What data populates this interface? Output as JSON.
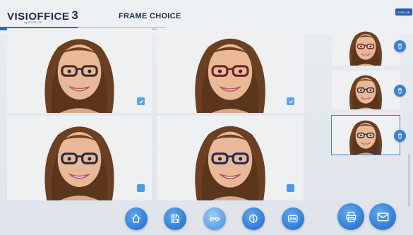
{
  "header": {
    "logo_main": "VISIOFFICE",
    "logo_number": "3",
    "logo_subtitle": "by ESSILOR",
    "page_title": "FRAME CHOICE",
    "progress": 0.47,
    "brand_badge": "ESSILOR"
  },
  "photos": [
    {
      "name": "photo-frame-1",
      "checked": true
    },
    {
      "name": "photo-frame-2",
      "checked": true
    },
    {
      "name": "photo-frame-3",
      "checked": false
    },
    {
      "name": "photo-frame-4",
      "checked": false
    }
  ],
  "thumbnails": [
    {
      "name": "thumbnail-1",
      "selected": false
    },
    {
      "name": "thumbnail-2",
      "selected": false
    },
    {
      "name": "thumbnail-3",
      "selected": true
    }
  ],
  "toolbar": {
    "left": [
      {
        "name": "home-button",
        "icon": "home-icon"
      },
      {
        "name": "save-button",
        "icon": "save-icon"
      },
      {
        "name": "glasses-button",
        "icon": "glasses-icon",
        "active": true
      },
      {
        "name": "compare-button",
        "icon": "compare-icon"
      },
      {
        "name": "frames-button",
        "icon": "frames-icon"
      }
    ],
    "right": [
      {
        "name": "print-button",
        "icon": "print-icon"
      },
      {
        "name": "email-button",
        "icon": "email-icon"
      }
    ]
  },
  "colors": {
    "accent": "#2f7bd6",
    "progress_fill": "#1a6fd1",
    "progress_track": "#b9d2ee",
    "title": "#1d2d4a"
  }
}
